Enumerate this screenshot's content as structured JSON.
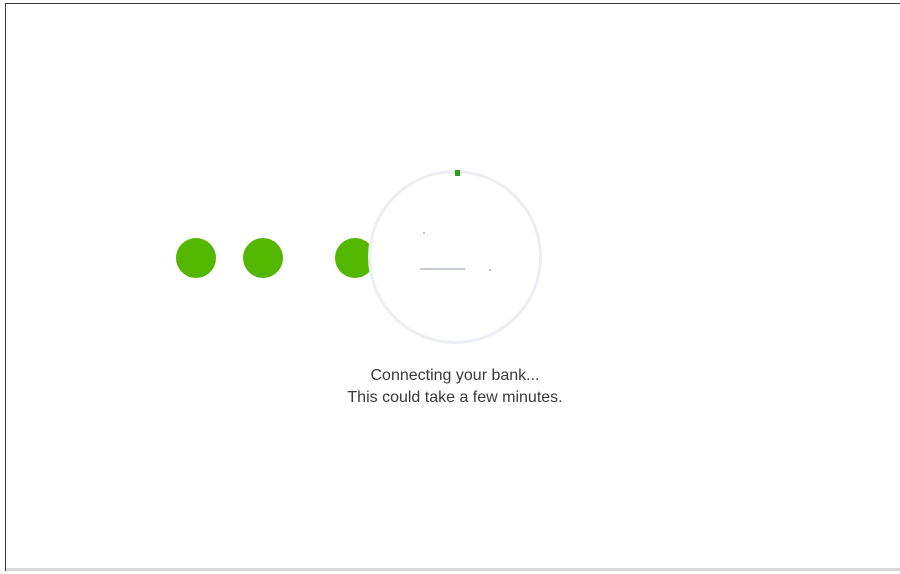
{
  "loader": {
    "accent_color": "#53b700",
    "progress_color": "#2ca01c",
    "ring_color": "#eceef3",
    "dots": [
      "dot",
      "dot",
      "dot"
    ],
    "center_icon": "bank-icon-loading"
  },
  "status": {
    "line1": "Connecting your bank...",
    "line2": "This could take a few minutes."
  }
}
